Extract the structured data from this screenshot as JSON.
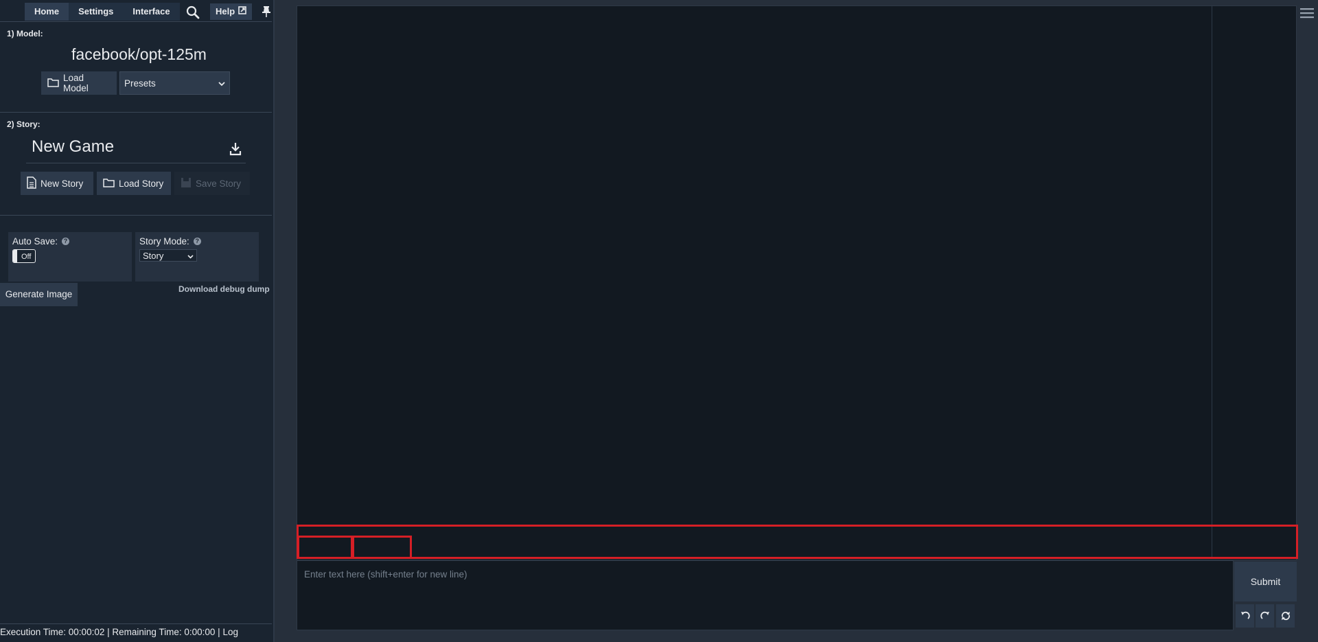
{
  "nav": {
    "tabs": [
      "Home",
      "Settings",
      "Interface"
    ],
    "help_label": "Help"
  },
  "model": {
    "section_label": "1) Model:",
    "name": "facebook/opt-125m",
    "load_label": "Load Model",
    "presets_value": "Presets"
  },
  "story": {
    "section_label": "2) Story:",
    "title": "New Game",
    "new_label": "New Story",
    "load_label": "Load Story",
    "save_label": "Save Story"
  },
  "settings": {
    "autosave_label": "Auto Save:",
    "autosave_state": "Off",
    "storymode_label": "Story Mode:",
    "storymode_value": "Story",
    "help_glyph": "?"
  },
  "actions": {
    "debug_label": "Download debug dump",
    "generate_image_label": "Generate Image"
  },
  "status": {
    "text": "Execution Time: 00:00:02 | Remaining Time: 0:00:00 | Log"
  },
  "input": {
    "placeholder": "Enter text here (shift+enter for new line)",
    "submit_label": "Submit"
  },
  "colors": {
    "sidebar_bg": "#1a2430",
    "main_bg": "#262f3b",
    "story_bg": "#121921",
    "button_bg": "#2d3a4b",
    "highlight": "#d51f26"
  }
}
